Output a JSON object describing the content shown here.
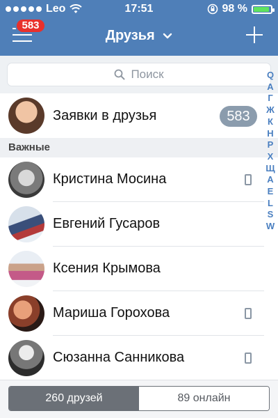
{
  "status_bar": {
    "carrier": "Leo",
    "time": "17:51",
    "battery": "98 %"
  },
  "header": {
    "title": "Друзья",
    "notifications_badge": "583",
    "icons": {
      "menu": "hamburger-icon",
      "title_dropdown": "chevron-down-icon",
      "add": "plus-icon"
    }
  },
  "search": {
    "placeholder": "Поиск"
  },
  "requests": {
    "label": "Заявки в друзья",
    "count": "583"
  },
  "section": {
    "title": "Важные"
  },
  "friends": [
    {
      "name": "Кристина Мосина",
      "mobile": true
    },
    {
      "name": "Евгений Гусаров",
      "mobile": false
    },
    {
      "name": "Ксения Крымова",
      "mobile": false
    },
    {
      "name": "Мариша Горохова",
      "mobile": true
    },
    {
      "name": "Сюзанна Санникова",
      "mobile": true
    }
  ],
  "alphabet": [
    "Q",
    "А",
    "Г",
    "Ж",
    "К",
    "Н",
    "Р",
    "Х",
    "Щ",
    "А",
    "Е",
    "L",
    "S",
    "W"
  ],
  "tabs": [
    {
      "label": "260 друзей",
      "active": true
    },
    {
      "label": "89 онлайн",
      "active": false
    }
  ]
}
